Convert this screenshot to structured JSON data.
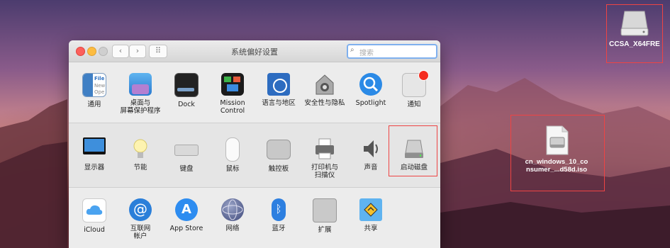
{
  "window": {
    "title": "系统偏好设置",
    "search_placeholder": "搜索",
    "nav_back": "‹",
    "nav_forward": "›",
    "grid": "⠿"
  },
  "rows": [
    [
      {
        "label": "通用",
        "icon": "general-icon"
      },
      {
        "label": "桌面与",
        "label2": "屏幕保护程序",
        "icon": "desktop-icon"
      },
      {
        "label": "Dock",
        "icon": "dock-icon"
      },
      {
        "label": "Mission",
        "label2": "Control",
        "icon": "mission-control-icon"
      },
      {
        "label": "语言与地区",
        "icon": "language-icon"
      },
      {
        "label": "安全性与隐私",
        "icon": "security-icon"
      },
      {
        "label": "Spotlight",
        "icon": "spotlight-icon"
      },
      {
        "label": "通知",
        "icon": "notifications-icon"
      }
    ],
    [
      {
        "label": "显示器",
        "icon": "display-icon"
      },
      {
        "label": "节能",
        "icon": "energy-icon"
      },
      {
        "label": "键盘",
        "icon": "keyboard-icon"
      },
      {
        "label": "鼠标",
        "icon": "mouse-icon"
      },
      {
        "label": "触控板",
        "icon": "trackpad-icon"
      },
      {
        "label": "打印机与",
        "label2": "扫描仪",
        "icon": "printer-icon"
      },
      {
        "label": "声音",
        "icon": "sound-icon"
      },
      {
        "label": "启动磁盘",
        "icon": "startup-disk-icon"
      }
    ],
    [
      {
        "label": "iCloud",
        "icon": "icloud-icon"
      },
      {
        "label": "互联网",
        "label2": "帐户",
        "icon": "internet-accounts-icon"
      },
      {
        "label": "App Store",
        "icon": "app-store-icon"
      },
      {
        "label": "网络",
        "icon": "network-icon"
      },
      {
        "label": "蓝牙",
        "icon": "bluetooth-icon"
      },
      {
        "label": "扩展",
        "icon": "extensions-icon"
      },
      {
        "label": "共享",
        "icon": "sharing-icon"
      }
    ]
  ],
  "desktop": {
    "drive_label": "CCSA_X64FRE",
    "iso_label_line1": "cn_windows_10_co",
    "iso_label_line2": "nsumer_...d58d.iso"
  },
  "colors": {
    "close": "#fc605c",
    "minimize": "#fdbc40",
    "zoom": "#c8c8c8",
    "highlight": "#e44444",
    "search_focus": "#7fb0ee"
  }
}
